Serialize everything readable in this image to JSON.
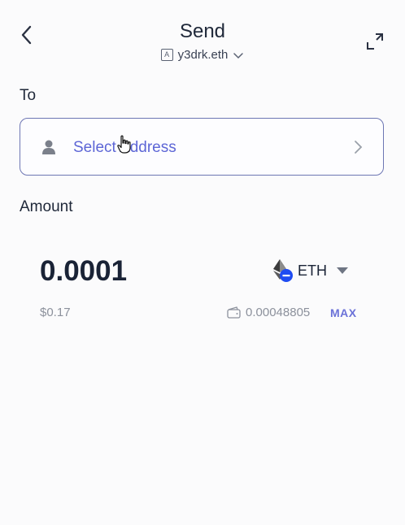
{
  "header": {
    "title": "Send",
    "account_badge": "A",
    "account_name": "y3drk.eth",
    "back_icon": "chevron-left-icon",
    "expand_icon": "expand-icon"
  },
  "to": {
    "label": "To",
    "address_placeholder": "Select Address",
    "user_icon": "user-icon",
    "chevron_icon": "chevron-right-icon"
  },
  "amount": {
    "label": "Amount",
    "value": "0.0001",
    "fiat_value": "$0.17",
    "token_symbol": "ETH",
    "balance": "0.00048805",
    "max_label": "MAX",
    "wallet_icon": "wallet-icon"
  },
  "colors": {
    "accent": "#5d66d6",
    "text_primary": "#1c2435",
    "text_muted": "#8c919c",
    "border": "#6d76b3",
    "token_badge": "#1f4cf2"
  }
}
